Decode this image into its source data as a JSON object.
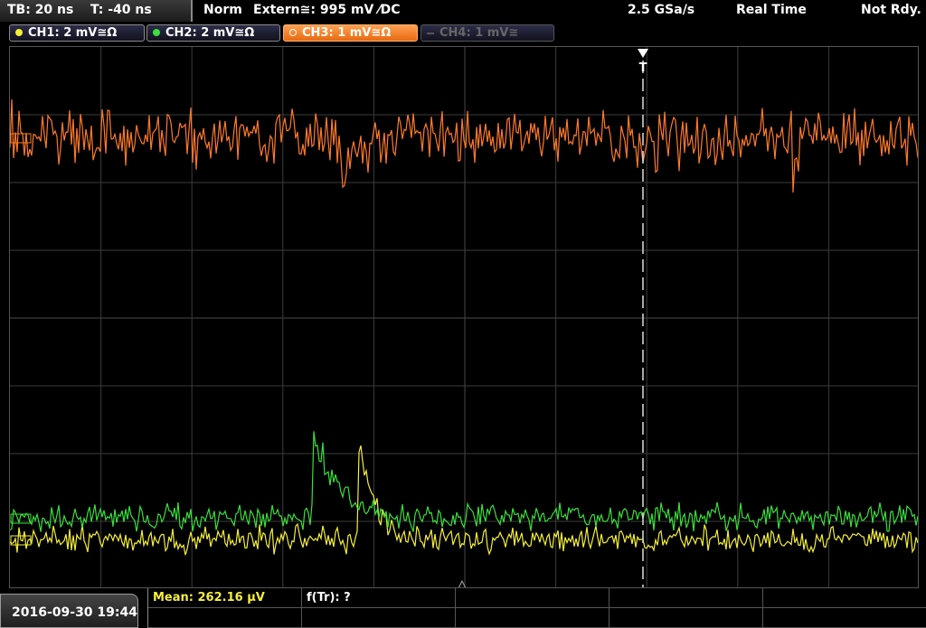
{
  "header": {
    "timebase": "TB: 20 ns",
    "trigger_time": "T: -40 ns",
    "mode": "Norm",
    "trigger_source": "Extern≅: 995 mV ⁄DC",
    "sample_rate": "2.5 GSa/s",
    "acquisition": "Real Time",
    "status": "Not Rdy."
  },
  "channels": [
    {
      "label": "CH1: 2 mV≅Ω",
      "color": "#f5ef3a",
      "active": true
    },
    {
      "label": "CH2: 2 mV≅Ω",
      "color": "#3adf3a",
      "active": true
    },
    {
      "label": "CH3: 1 mV≅Ω",
      "color": "#ff8a2e",
      "active": true,
      "selected": true
    },
    {
      "label": "CH4: 1 mV≅",
      "color": "#555555",
      "active": false
    }
  ],
  "trigger_marker": "T",
  "footer": {
    "datetime": "2016-09-30 19:44",
    "measurement_mean": "Mean: 262.16 µV",
    "measurement_ftr": "f(Tr): ?"
  },
  "colors": {
    "ch1": "#f5ef3a",
    "ch2": "#3adf3a",
    "ch3": "#ff7a2a",
    "grid": "#3c3c3c"
  }
}
